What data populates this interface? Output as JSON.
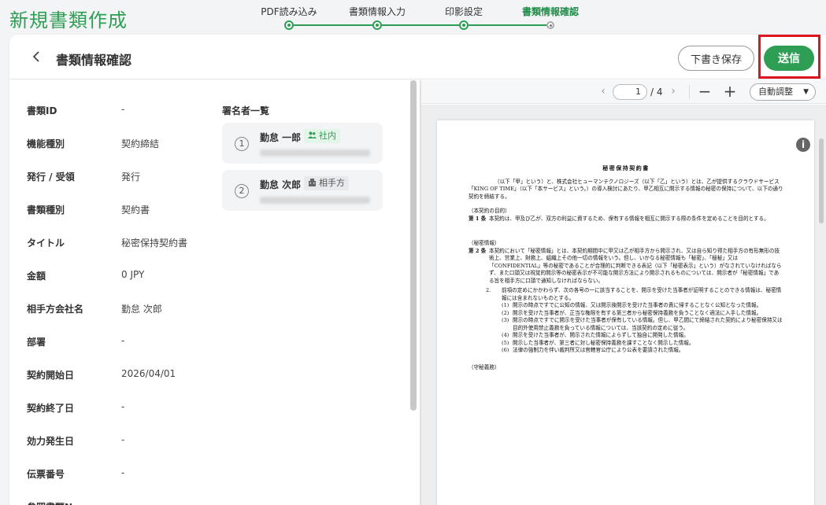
{
  "app": {
    "title": "新規書類作成"
  },
  "stepper": {
    "steps": [
      {
        "label": "PDF読み込み"
      },
      {
        "label": "書類情報入力"
      },
      {
        "label": "印影設定"
      },
      {
        "label": "書類情報確認"
      }
    ],
    "current_step": 4
  },
  "header": {
    "title": "書類情報確認",
    "draft_label": "下書き保存",
    "send_label": "送信"
  },
  "info": {
    "rows": [
      {
        "label": "書類ID",
        "value": "-"
      },
      {
        "label": "機能種別",
        "value": "契約締結"
      },
      {
        "label": "発行 / 受領",
        "value": "発行"
      },
      {
        "label": "書類種別",
        "value": "契約書"
      },
      {
        "label": "タイトル",
        "value": "秘密保持契約書"
      },
      {
        "label": "金額",
        "value": "0 JPY"
      },
      {
        "label": "相手方会社名",
        "value": "勤怠 次郎"
      },
      {
        "label": "部署",
        "value": "-"
      },
      {
        "label": "契約開始日",
        "value": "2026/04/01"
      },
      {
        "label": "契約終了日",
        "value": "-"
      },
      {
        "label": "効力発生日",
        "value": "-"
      },
      {
        "label": "伝票番号",
        "value": "-"
      },
      {
        "label": "参照書類No",
        "value": "-"
      }
    ]
  },
  "signers": {
    "title": "署名者一覧",
    "items": [
      {
        "num": "1",
        "name": "勤怠 一郎",
        "tag": "社内",
        "tag_icon": "people-icon"
      },
      {
        "num": "2",
        "name": "勤怠 次郎",
        "tag": "相手方",
        "tag_icon": "building-icon"
      }
    ]
  },
  "viewer": {
    "current_page": "1",
    "total_pages": "/ 4",
    "zoom_label": "自動調整"
  },
  "document": {
    "title": "秘密保持契約書",
    "intro": "（以下「甲」という）と、株式会社ヒューマンテクノロジーズ（以下「乙」という）とは、乙が提供するクラウドサービス「KING OF TIME」（以下「本サービス」という。）の導入検討にあたり、甲乙相互に開示する情報の秘密の保持について、以下の通り契約を締結する。",
    "sec1_head": "（本契約の目的）",
    "art1_no": "第 1 条",
    "art1_text": "本契約は、甲及び乙が、双方の利益に資するため、保有する情報を相互に開示する際の条件を定めることを目的とする。",
    "sec2_head": "（秘密情報）",
    "art2_no": "第 2 条",
    "art2_text": "本契約において「秘密情報」とは、本契約期間中に甲又は乙が相手方から開示され、又は自ら知り得た相手方の有形無形の技術上、営業上、財務上、組織上その他一切の情報をいう。但し、いかなる秘密情報も「秘密」、「極秘」又は「CONFIDENTIAL」等の秘密であることが合理的に判断できる表記（以下「秘密表示」という）がなされていなければならず、また口頭又は視覚的開示等の秘密表示が不可能な開示方法により開示されるものについては、開示者が「秘密情報」である旨を相手方に口頭で通知しなければならない。",
    "item2_no": "2.",
    "item2_text": "前項の定めにかかわらず、次の各号の一に該当することを、開示を受けた当事者が証明することのできる情報は、秘密情報には含まれないものとする。",
    "subs": [
      {
        "no": "(1)",
        "text": "開示の時点ですでに公知の情報、又は開示後開示を受けた当事者の責に帰することなく公知となった情報。"
      },
      {
        "no": "(2)",
        "text": "開示を受けた当事者が、正当な権限を有する第三者から秘密保持義務を負うことなく適法に入手した情報。"
      },
      {
        "no": "(3)",
        "text": "開示の時点ですでに開示を受けた当事者が保有している情報。但し、甲乙間にて締結された契約により秘密保持又は目的外使用禁止義務を負っている情報については、当該契約の定めに従う。"
      },
      {
        "no": "(4)",
        "text": "開示を受けた当事者が、開示された情報によらずして独自に開発した情報。"
      },
      {
        "no": "(5)",
        "text": "開示した当事者が、第三者に対し秘密保持義務を課すことなく開示した情報。"
      },
      {
        "no": "(6)",
        "text": "法律の強制力を伴い裁判所又は官轄官公庁により公表を要請された情報。"
      }
    ],
    "sec3_head": "（守秘義務）"
  }
}
